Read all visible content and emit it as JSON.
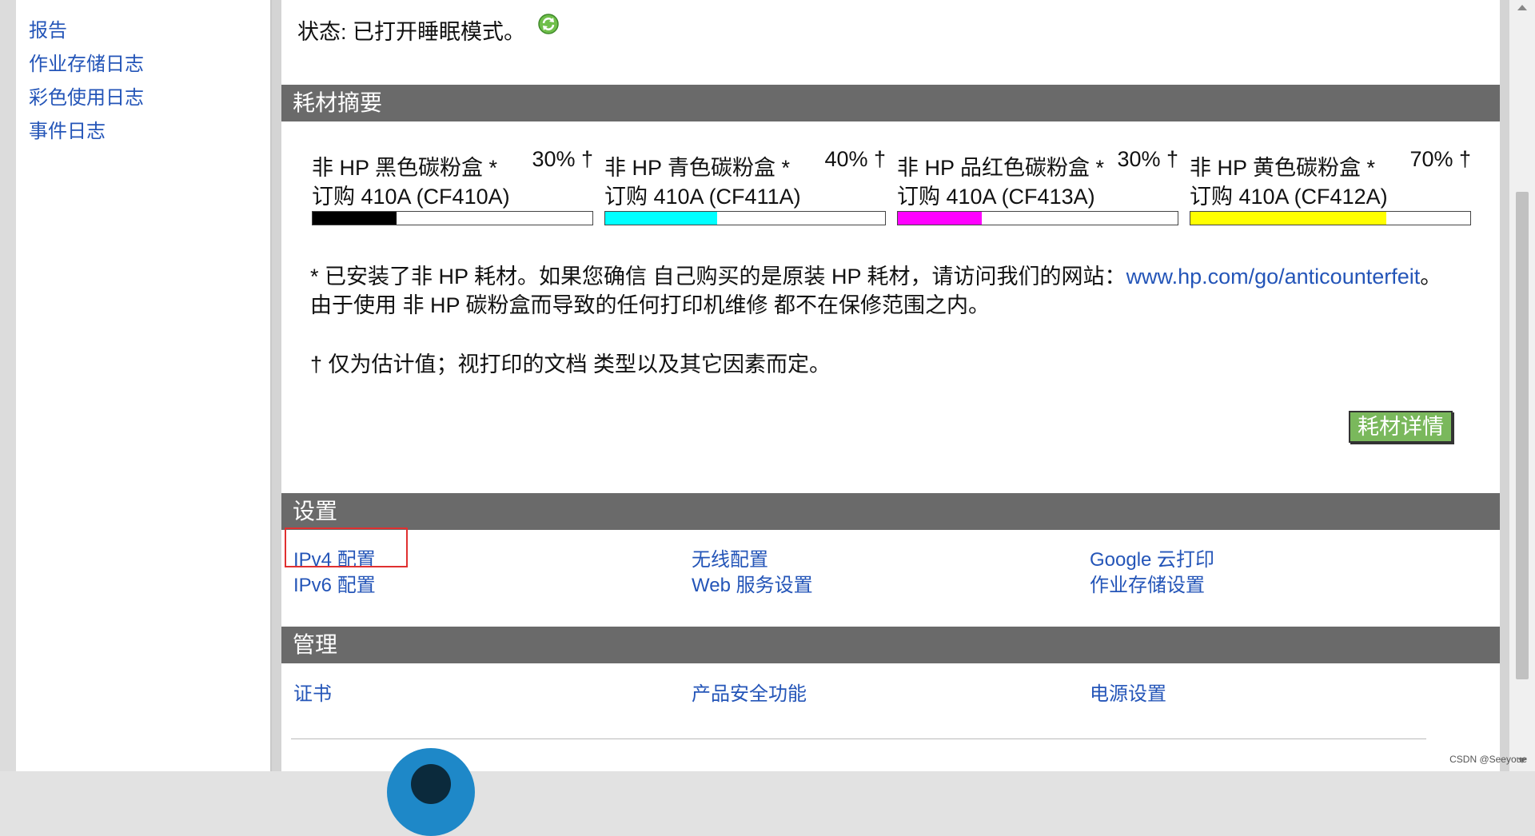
{
  "sidebar": {
    "links": [
      {
        "label": "报告"
      },
      {
        "label": "作业存储日志"
      },
      {
        "label": "彩色使用日志"
      },
      {
        "label": "事件日志"
      }
    ]
  },
  "status": {
    "text": "状态: 已打开睡眠模式。",
    "refresh_icon": "refresh-icon"
  },
  "supplies": {
    "title": "耗材摘要",
    "cartridges": [
      {
        "name": "非 HP 黑色碳粉盒 *",
        "percent": "30% †",
        "order": "订购 410A (CF410A)",
        "level": 0.3,
        "color": "#000000"
      },
      {
        "name": "非 HP 青色碳粉盒 *",
        "percent": "40% †",
        "order": "订购 410A (CF411A)",
        "level": 0.4,
        "color": "#00ffff"
      },
      {
        "name": "非 HP 品红色碳粉盒 *",
        "percent": "30% †",
        "order": "订购 410A (CF413A)",
        "level": 0.3,
        "color": "#ff00ff"
      },
      {
        "name": "非 HP 黄色碳粉盒 *",
        "percent": "70% †",
        "order": "订购 410A (CF412A)",
        "level": 0.7,
        "color": "#ffff00"
      }
    ],
    "note1_text": "* 已安装了非 HP 耗材。如果您确信 自己购买的是原装 HP 耗材，请访问我们的网站：",
    "note1_link": "www.hp.com/go/anticounterfeit",
    "note1_end": "。",
    "note2": "由于使用 非 HP 碳粉盒而导致的任何打印机维修 都不在保修范围之内。",
    "note3": "† 仅为估计值；视打印的文档 类型以及其它因素而定。",
    "details_button": "耗材详情"
  },
  "settings": {
    "title": "设置",
    "links": [
      "IPv4 配置",
      "IPv6 配置",
      "无线配置",
      "Web 服务设置",
      "Google 云打印",
      "作业存储设置"
    ]
  },
  "management": {
    "title": "管理",
    "links": [
      "证书",
      "产品安全功能",
      "电源设置"
    ]
  },
  "watermark": "CSDN @Seeyoue"
}
